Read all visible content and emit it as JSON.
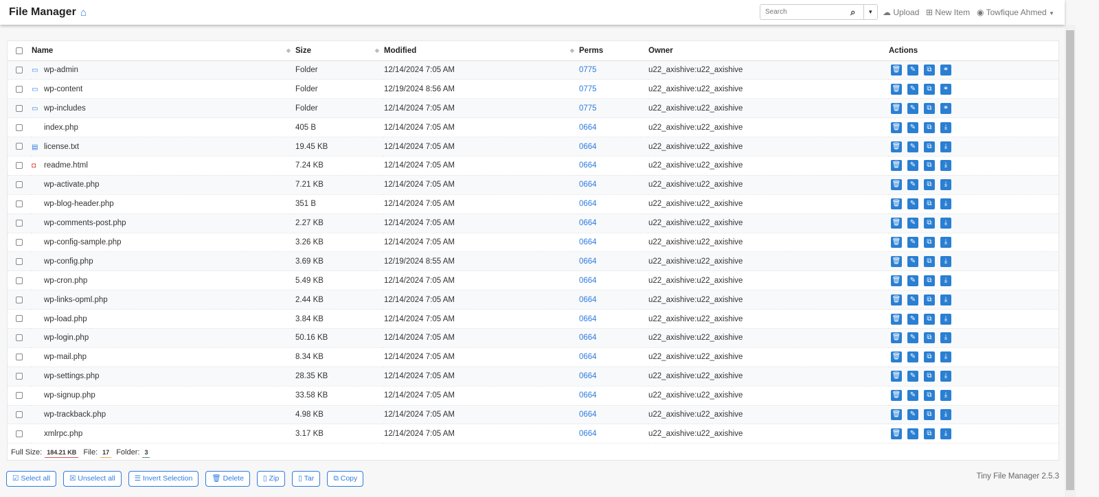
{
  "header": {
    "title": "File Manager",
    "search_placeholder": "Search",
    "upload": "Upload",
    "new_item": "New Item",
    "user": "Towfique Ahmed"
  },
  "columns": {
    "name": "Name",
    "size": "Size",
    "modified": "Modified",
    "perms": "Perms",
    "owner": "Owner",
    "actions": "Actions"
  },
  "rows": [
    {
      "type": "folder",
      "name": "wp-admin",
      "size": "Folder",
      "modified": "12/14/2024 7:05 AM",
      "perms": "0775",
      "owner": "u22_axishive:u22_axishive"
    },
    {
      "type": "folder",
      "name": "wp-content",
      "size": "Folder",
      "modified": "12/19/2024 8:56 AM",
      "perms": "0775",
      "owner": "u22_axishive:u22_axishive"
    },
    {
      "type": "folder",
      "name": "wp-includes",
      "size": "Folder",
      "modified": "12/14/2024 7:05 AM",
      "perms": "0775",
      "owner": "u22_axishive:u22_axishive"
    },
    {
      "type": "php",
      "name": "index.php",
      "size": "405 B",
      "modified": "12/14/2024 7:05 AM",
      "perms": "0664",
      "owner": "u22_axishive:u22_axishive"
    },
    {
      "type": "txt",
      "name": "license.txt",
      "size": "19.45 KB",
      "modified": "12/14/2024 7:05 AM",
      "perms": "0664",
      "owner": "u22_axishive:u22_axishive"
    },
    {
      "type": "html",
      "name": "readme.html",
      "size": "7.24 KB",
      "modified": "12/14/2024 7:05 AM",
      "perms": "0664",
      "owner": "u22_axishive:u22_axishive"
    },
    {
      "type": "php",
      "name": "wp-activate.php",
      "size": "7.21 KB",
      "modified": "12/14/2024 7:05 AM",
      "perms": "0664",
      "owner": "u22_axishive:u22_axishive"
    },
    {
      "type": "php",
      "name": "wp-blog-header.php",
      "size": "351 B",
      "modified": "12/14/2024 7:05 AM",
      "perms": "0664",
      "owner": "u22_axishive:u22_axishive"
    },
    {
      "type": "php",
      "name": "wp-comments-post.php",
      "size": "2.27 KB",
      "modified": "12/14/2024 7:05 AM",
      "perms": "0664",
      "owner": "u22_axishive:u22_axishive"
    },
    {
      "type": "php",
      "name": "wp-config-sample.php",
      "size": "3.26 KB",
      "modified": "12/14/2024 7:05 AM",
      "perms": "0664",
      "owner": "u22_axishive:u22_axishive"
    },
    {
      "type": "php",
      "name": "wp-config.php",
      "size": "3.69 KB",
      "modified": "12/19/2024 8:55 AM",
      "perms": "0664",
      "owner": "u22_axishive:u22_axishive"
    },
    {
      "type": "php",
      "name": "wp-cron.php",
      "size": "5.49 KB",
      "modified": "12/14/2024 7:05 AM",
      "perms": "0664",
      "owner": "u22_axishive:u22_axishive"
    },
    {
      "type": "php",
      "name": "wp-links-opml.php",
      "size": "2.44 KB",
      "modified": "12/14/2024 7:05 AM",
      "perms": "0664",
      "owner": "u22_axishive:u22_axishive"
    },
    {
      "type": "php",
      "name": "wp-load.php",
      "size": "3.84 KB",
      "modified": "12/14/2024 7:05 AM",
      "perms": "0664",
      "owner": "u22_axishive:u22_axishive"
    },
    {
      "type": "php",
      "name": "wp-login.php",
      "size": "50.16 KB",
      "modified": "12/14/2024 7:05 AM",
      "perms": "0664",
      "owner": "u22_axishive:u22_axishive"
    },
    {
      "type": "php",
      "name": "wp-mail.php",
      "size": "8.34 KB",
      "modified": "12/14/2024 7:05 AM",
      "perms": "0664",
      "owner": "u22_axishive:u22_axishive"
    },
    {
      "type": "php",
      "name": "wp-settings.php",
      "size": "28.35 KB",
      "modified": "12/14/2024 7:05 AM",
      "perms": "0664",
      "owner": "u22_axishive:u22_axishive"
    },
    {
      "type": "php",
      "name": "wp-signup.php",
      "size": "33.58 KB",
      "modified": "12/14/2024 7:05 AM",
      "perms": "0664",
      "owner": "u22_axishive:u22_axishive"
    },
    {
      "type": "php",
      "name": "wp-trackback.php",
      "size": "4.98 KB",
      "modified": "12/14/2024 7:05 AM",
      "perms": "0664",
      "owner": "u22_axishive:u22_axishive"
    },
    {
      "type": "php",
      "name": "xmlrpc.php",
      "size": "3.17 KB",
      "modified": "12/14/2024 7:05 AM",
      "perms": "0664",
      "owner": "u22_axishive:u22_axishive"
    }
  ],
  "summary": {
    "full_size_label": "Full Size:",
    "full_size": "184.21 KB",
    "file_label": "File:",
    "file_count": "17",
    "folder_label": "Folder:",
    "folder_count": "3"
  },
  "buttons": {
    "select_all": "Select all",
    "unselect_all": "Unselect all",
    "invert": "Invert Selection",
    "delete": "Delete",
    "zip": "Zip",
    "tar": "Tar",
    "copy": "Copy"
  },
  "version": "Tiny File Manager 2.5.3"
}
